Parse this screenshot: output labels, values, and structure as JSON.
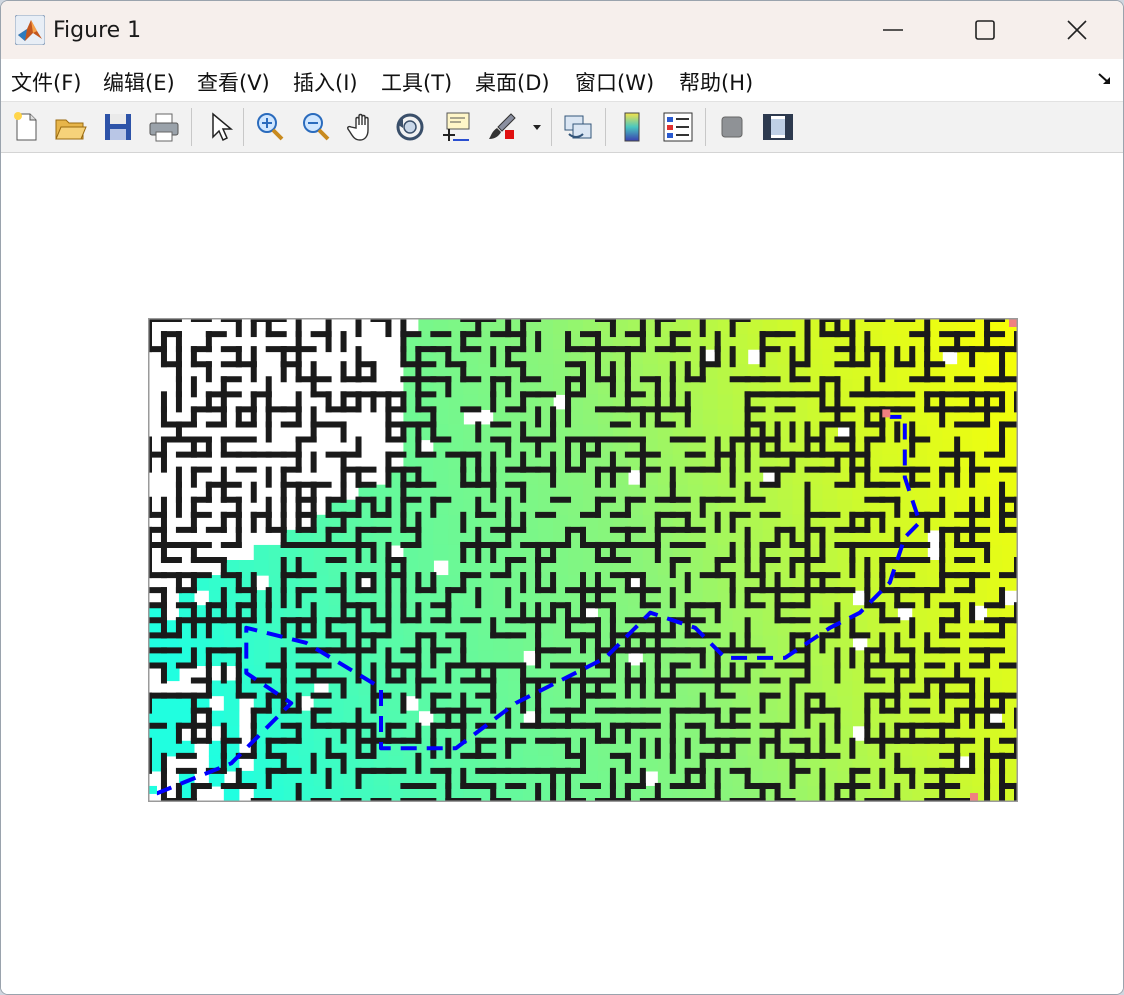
{
  "window": {
    "title": "Figure 1"
  },
  "menu": {
    "items": [
      {
        "id": "file",
        "label": "文件(F)"
      },
      {
        "id": "edit",
        "label": "编辑(E)"
      },
      {
        "id": "view",
        "label": "查看(V)"
      },
      {
        "id": "insert",
        "label": "插入(I)"
      },
      {
        "id": "tools",
        "label": "工具(T)"
      },
      {
        "id": "desktop",
        "label": "桌面(D)"
      },
      {
        "id": "window",
        "label": "窗口(W)"
      },
      {
        "id": "help",
        "label": "帮助(H)"
      }
    ]
  },
  "toolbar": {
    "buttons": [
      "new-figure-icon",
      "open-file-icon",
      "save-icon",
      "print-icon",
      "pointer-icon",
      "zoom-in-icon",
      "zoom-out-icon",
      "pan-hand-icon",
      "rotate-3d-icon",
      "data-cursor-icon",
      "brush-icon",
      "brush-dropdown-icon",
      "link-plot-icon",
      "colorbar-icon",
      "legend-icon",
      "hide-plot-tools-icon",
      "show-plot-tools-icon"
    ]
  },
  "chart_data": {
    "type": "heatmap",
    "description_colormap": "distance field from cyan (start, bottom-left) through green to yellow (end, top-right); walls black; unreached cells white",
    "grid": {
      "cols": 58,
      "rows": 32
    },
    "path": {
      "style": "dashed",
      "color": "#0000ff",
      "start_cell": [
        0,
        31
      ],
      "end_cell": [
        49,
        6
      ]
    },
    "colors": {
      "wall": "#1a1a1a",
      "unreached": "#ffffff",
      "start": "#20ffe0",
      "end": "#ffff00",
      "marker": "#f08080"
    }
  }
}
